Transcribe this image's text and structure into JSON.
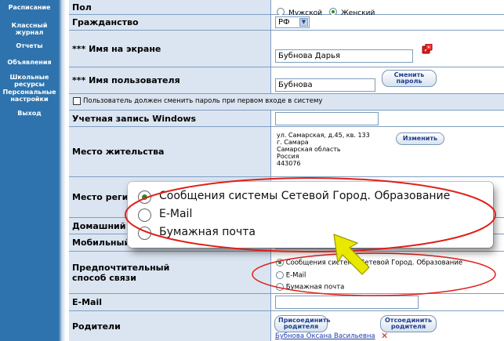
{
  "sidebar": {
    "items": [
      {
        "label": "Расписание"
      },
      {
        "label": "Классный\nжурнал"
      },
      {
        "label": "Отчеты"
      },
      {
        "label": "Объявления"
      },
      {
        "label": "Школьные\nресурсы"
      },
      {
        "label": "Персональные\nнастройки"
      },
      {
        "label": "Выход"
      }
    ]
  },
  "form": {
    "gender": {
      "label": "Пол",
      "male": "Мужской",
      "female": "Женский",
      "selected": "female"
    },
    "citizenship": {
      "label": "Гражданство",
      "value": "РФ"
    },
    "screen_name": {
      "label": "*** Имя на экране",
      "value": "Бубнова Дарья"
    },
    "username": {
      "label": "*** Имя пользователя",
      "value": "Бубнова",
      "change_button": "Сменить\nпароль"
    },
    "must_change_password": {
      "label": "Пользователь должен сменить пароль при первом входе в систему",
      "checked": false
    },
    "windows_account": {
      "label": "Учетная запись Windows",
      "value": ""
    },
    "residence": {
      "label": "Место жительства",
      "address_lines": [
        "ул. Самарская, д.45, кв. 133",
        "г. Самара",
        "Самарская область",
        "Россия",
        "443076"
      ],
      "change_button": "Изменить"
    },
    "registration": {
      "label": "Место регистр"
    },
    "home_phone": {
      "label": "Домашний тел"
    },
    "mobile_phone": {
      "label": "Мобильный телефон",
      "value": ""
    },
    "contact_method": {
      "label": "Предпочтительный\nспособ связи",
      "options": [
        "Сообщения системы Сетевой Город. Образование",
        "E-Mail",
        "Бумажная почта"
      ],
      "selected": 0
    },
    "email": {
      "label": "E-Mail",
      "value": ""
    },
    "parents": {
      "label": "Родители",
      "attach_button": "Присоединить\nродителя",
      "detach_button": "Отсоединить\nродителя",
      "parent_name": "Бубнова Оксана Васильевна"
    }
  },
  "zoom_callout": {
    "options": [
      "Сообщения системы Сетевой Город. Образование",
      "E-Mail",
      "Бумажная почта"
    ],
    "selected": 0
  },
  "colors": {
    "sidebar": "#2e73ad",
    "label_bg": "#dbe5f1",
    "highlight_ellipse": "#e0201b",
    "arrow": "#e8e800",
    "link": "#1f3fb0",
    "radio_dot": "#2d8a2d"
  }
}
